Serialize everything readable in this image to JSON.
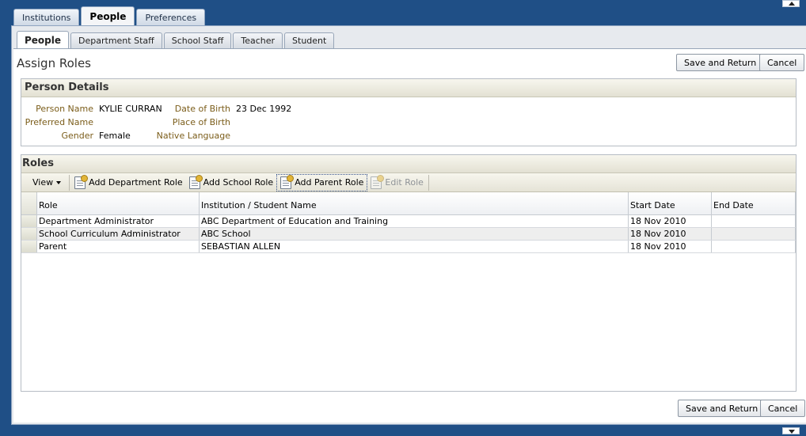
{
  "top_tabs": [
    "Institutions",
    "People",
    "Preferences"
  ],
  "top_tab_active": 1,
  "sub_tabs": [
    "People",
    "Department Staff",
    "School Staff",
    "Teacher",
    "Student"
  ],
  "sub_tab_active": 0,
  "page": {
    "title": "Assign Roles",
    "save_label": "Save and Return",
    "cancel_label": "Cancel"
  },
  "person_details": {
    "header": "Person Details",
    "left": [
      {
        "label": "Person Name",
        "value": "KYLIE CURRAN"
      },
      {
        "label": "Preferred Name",
        "value": ""
      },
      {
        "label": "Gender",
        "value": "Female"
      }
    ],
    "right": [
      {
        "label": "Date of Birth",
        "value": "23 Dec 1992"
      },
      {
        "label": "Place of Birth",
        "value": ""
      },
      {
        "label": "Native Language",
        "value": ""
      }
    ]
  },
  "roles": {
    "header": "Roles",
    "toolbar": {
      "view": "View",
      "add_department": "Add Department Role",
      "add_school": "Add School Role",
      "add_parent": "Add Parent Role",
      "edit": "Edit Role"
    },
    "columns": [
      "Role",
      "Institution / Student Name",
      "Start Date",
      "End Date"
    ],
    "rows": [
      {
        "role": "Department Administrator",
        "institution": "ABC Department of Education and Training",
        "start": "18 Nov 2010",
        "end": ""
      },
      {
        "role": "School Curriculum Administrator",
        "institution": "ABC School",
        "start": "18 Nov 2010",
        "end": ""
      },
      {
        "role": "Parent",
        "institution": "SEBASTIAN ALLEN",
        "start": "18 Nov 2010",
        "end": ""
      }
    ]
  }
}
